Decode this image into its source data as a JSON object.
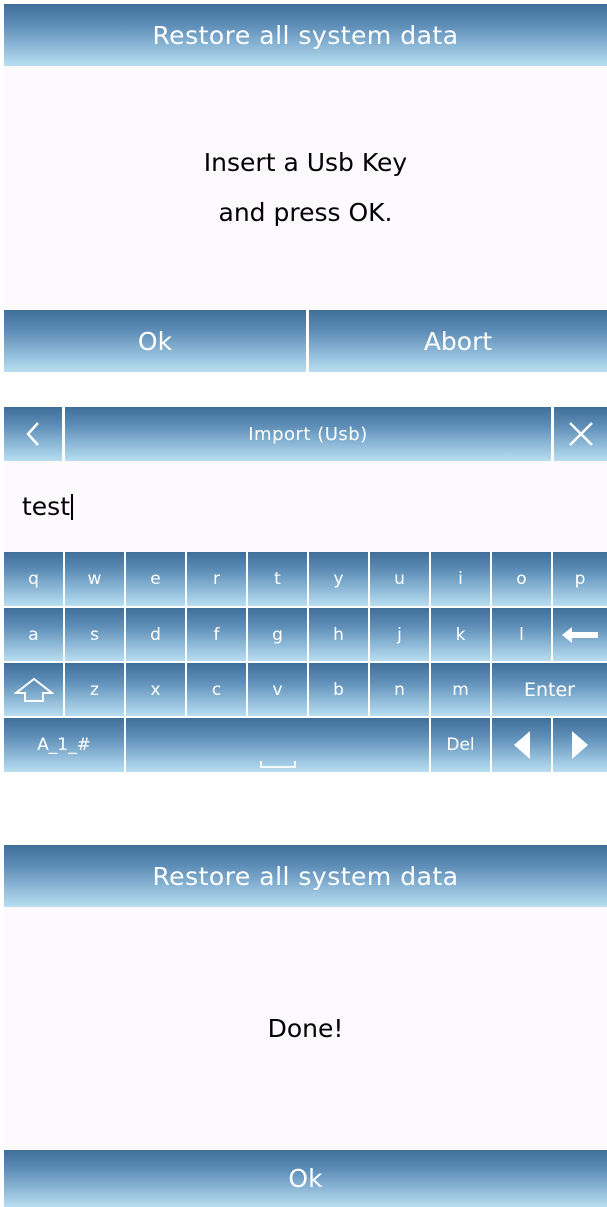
{
  "dialog1": {
    "title": "Restore all system data",
    "message_line1": "Insert a Usb Key",
    "message_line2": "and press OK.",
    "ok_label": "Ok",
    "abort_label": "Abort"
  },
  "keyboard_screen": {
    "title": "Import (Usb)",
    "input_value": "test",
    "back_icon": "chevron-left-icon",
    "close_icon": "close-icon",
    "row1": [
      "q",
      "w",
      "e",
      "r",
      "t",
      "y",
      "u",
      "i",
      "o",
      "p"
    ],
    "row2": [
      "a",
      "s",
      "d",
      "f",
      "g",
      "h",
      "j",
      "k",
      "l"
    ],
    "row3": [
      "z",
      "x",
      "c",
      "v",
      "b",
      "n",
      "m"
    ],
    "enter_label": "Enter",
    "mode_label": "A_1_#",
    "del_label": "Del",
    "space_icon": "space-icon",
    "backspace_icon": "backspace-arrow-icon",
    "shift_icon": "shift-up-arrow-icon",
    "left_icon": "triangle-left-icon",
    "right_icon": "triangle-right-icon"
  },
  "dialog2": {
    "title": "Restore all system data",
    "message": "Done!",
    "ok_label": "Ok"
  }
}
